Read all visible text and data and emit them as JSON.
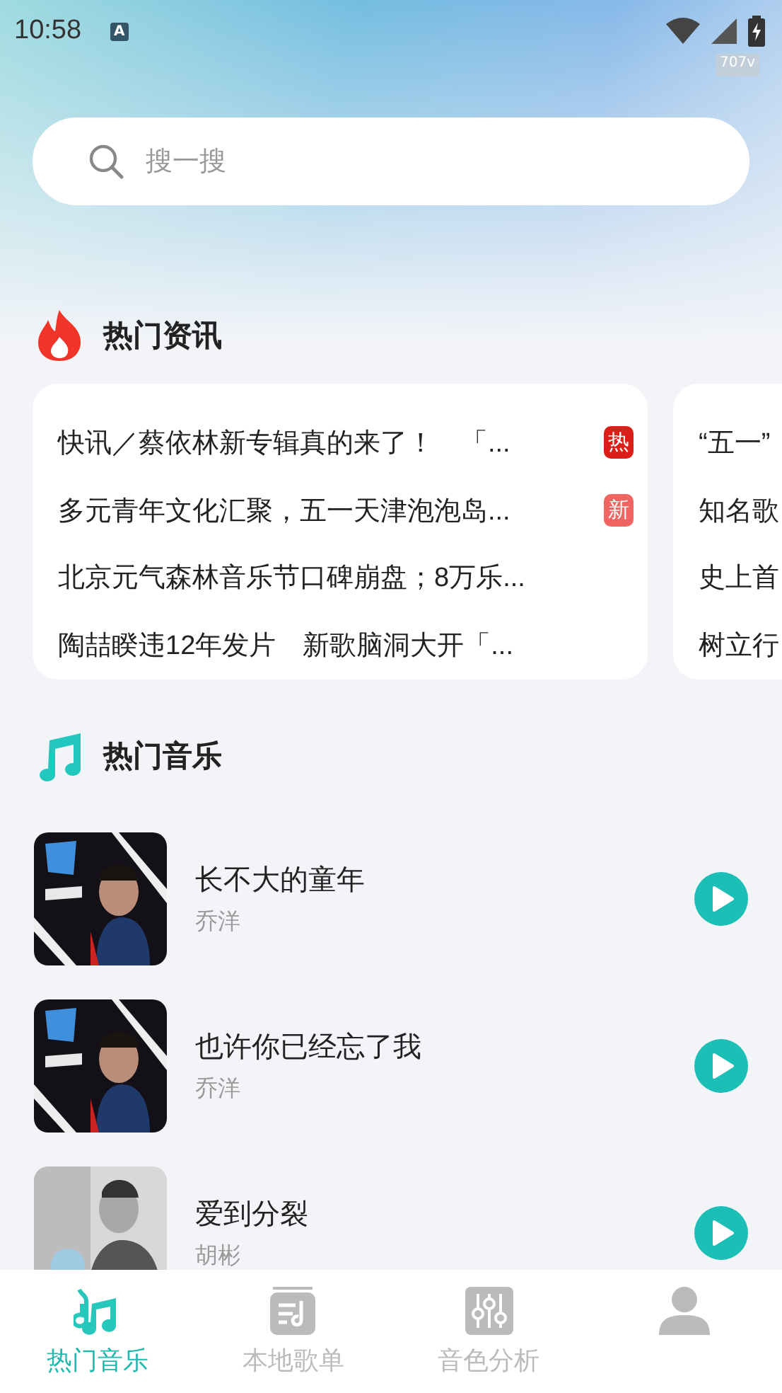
{
  "status_bar": {
    "time": "10:58",
    "badge": "A",
    "speed": "707v"
  },
  "search": {
    "placeholder": "搜一搜"
  },
  "news_section": {
    "title": "热门资讯"
  },
  "news_cards": [
    {
      "items": [
        {
          "text": "快讯／蔡依林新专辑真的来了！　「...",
          "tag": {
            "kind": "hot",
            "label": "热"
          }
        },
        {
          "text": "多元青年文化汇聚，五一天津泡泡岛...",
          "tag": {
            "kind": "new",
            "label": "新"
          }
        },
        {
          "text": "北京元气森林音乐节口碑崩盘；8万乐..."
        },
        {
          "text": "陶喆睽违12年发片　新歌脑洞大开「..."
        }
      ]
    },
    {
      "items": [
        {
          "text": "“五一”"
        },
        {
          "text": "知名歌"
        },
        {
          "text": "史上首"
        },
        {
          "text": "树立行"
        }
      ]
    }
  ],
  "music_section": {
    "title": "热门音乐"
  },
  "songs": [
    {
      "title": "长不大的童年",
      "artist": "乔洋"
    },
    {
      "title": "也许你已经忘了我",
      "artist": "乔洋"
    },
    {
      "title": "爱到分裂",
      "artist": "胡彬"
    }
  ],
  "tabs": [
    {
      "kind": "music",
      "label": "热门音乐",
      "selected": true
    },
    {
      "kind": "playlist",
      "label": "本地歌单",
      "selected": false
    },
    {
      "kind": "analysis",
      "label": "音色分析",
      "selected": false
    },
    {
      "kind": "profile",
      "selected": false
    }
  ]
}
